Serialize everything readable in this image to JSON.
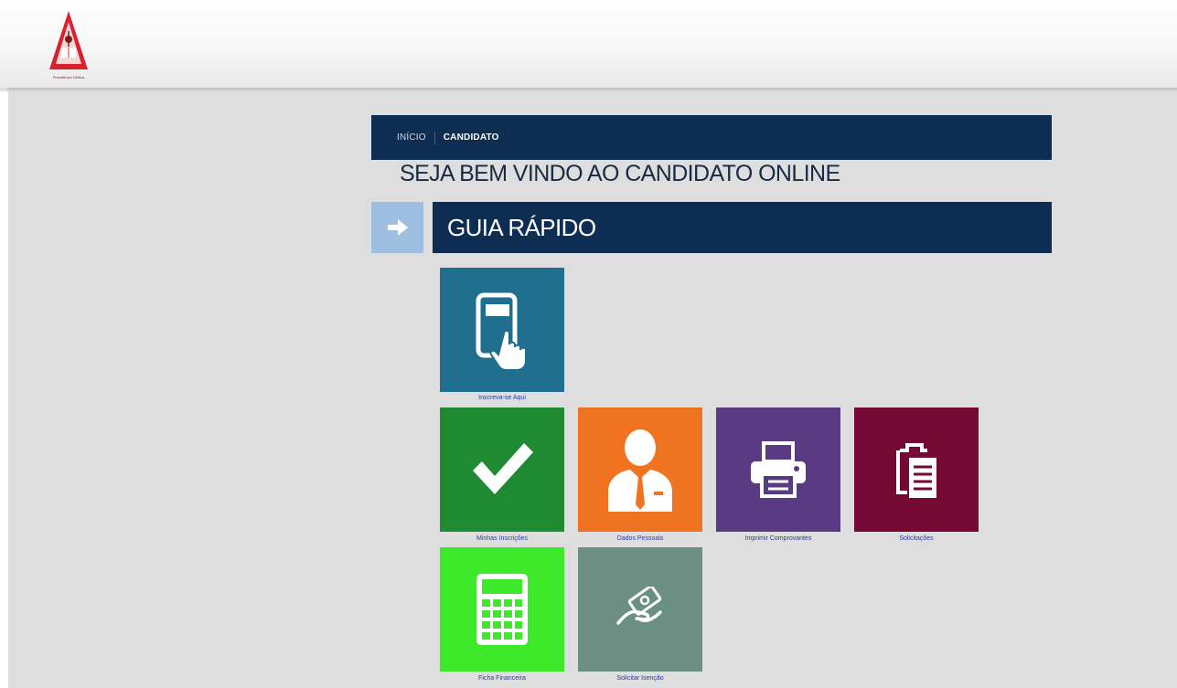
{
  "logo": {
    "caption": "Presidência Ofidica"
  },
  "breadcrumb": {
    "home": "INÍCIO",
    "current": "CANDIDATO"
  },
  "welcome": "SEJA BEM VINDO AO CANDIDATO ONLINE",
  "guide": {
    "title": "GUIA RÁPIDO",
    "icon": "arrow-right-icon"
  },
  "tiles": [
    {
      "label": "Inscreva-se Aqui",
      "icon": "tablet-touch-icon",
      "color": "#1f6e8e"
    },
    {
      "label": "Minhas Inscrições",
      "icon": "checkmark-icon",
      "color": "#1e8a32"
    },
    {
      "label": "Dados Pessoais",
      "icon": "person-icon",
      "color": "#ef7320"
    },
    {
      "label": "Imprimir Comprovantes",
      "icon": "printer-icon",
      "color": "#5a3a82"
    },
    {
      "label": "Solicitações",
      "icon": "clipboard-icon",
      "color": "#760836"
    },
    {
      "label": "Ficha Financeira",
      "icon": "calculator-icon",
      "color": "#3ee92c"
    },
    {
      "label": "Solicitar Isenção",
      "icon": "hand-money-icon",
      "color": "#6c8f83"
    }
  ],
  "colors": {
    "navy": "#0d2d53",
    "arrow_box": "#9ebfdf",
    "background": "#dedede",
    "label_link": "#2a3a9e"
  }
}
